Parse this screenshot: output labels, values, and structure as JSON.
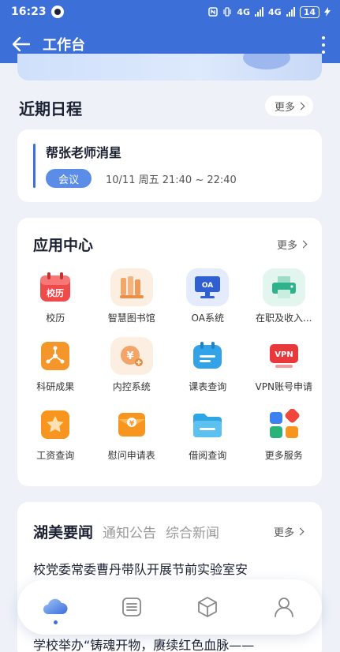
{
  "status": {
    "time": "16:23",
    "net1": "4G",
    "net2": "4G",
    "battery": "14"
  },
  "header": {
    "title": "工作台"
  },
  "schedule": {
    "title": "近期日程",
    "more": "更多",
    "event": {
      "title": "帮张老师消星",
      "tag": "会议",
      "time": "10/11 周五 21:40 ~ 22:40"
    }
  },
  "apps": {
    "title": "应用中心",
    "more": "更多",
    "items": [
      {
        "label": "校历",
        "icon": "calendar-icon",
        "badge": "校历"
      },
      {
        "label": "智慧图书馆",
        "icon": "library-icon"
      },
      {
        "label": "OA系统",
        "icon": "oa-monitor-icon",
        "badge": "OA"
      },
      {
        "label": "在职及收入...",
        "icon": "printer-icon"
      },
      {
        "label": "科研成果",
        "icon": "research-network-icon"
      },
      {
        "label": "内控系统",
        "icon": "finance-coin-icon"
      },
      {
        "label": "课表查询",
        "icon": "timetable-icon"
      },
      {
        "label": "VPN账号申请",
        "icon": "vpn-icon",
        "badge": "VPN"
      },
      {
        "label": "工资查询",
        "icon": "salary-star-icon"
      },
      {
        "label": "慰问申请表",
        "icon": "condolence-envelope-icon"
      },
      {
        "label": "借阅查询",
        "icon": "borrow-folder-icon"
      },
      {
        "label": "更多服务",
        "icon": "more-services-grid-icon"
      }
    ]
  },
  "news": {
    "tabs": [
      "湖美要闻",
      "通知公告",
      "综合新闻"
    ],
    "more": "更多",
    "items": [
      "校党委常委曹丹带队开展节前实验室安",
      "学校举办“铸魂开物，赓续红色血脉——"
    ]
  },
  "tabbar": {
    "items": [
      "home-cloud-icon",
      "list-icon",
      "cube-icon",
      "profile-icon"
    ]
  },
  "colors": {
    "primary": "#3d6fd9",
    "background": "#eef2f8"
  }
}
